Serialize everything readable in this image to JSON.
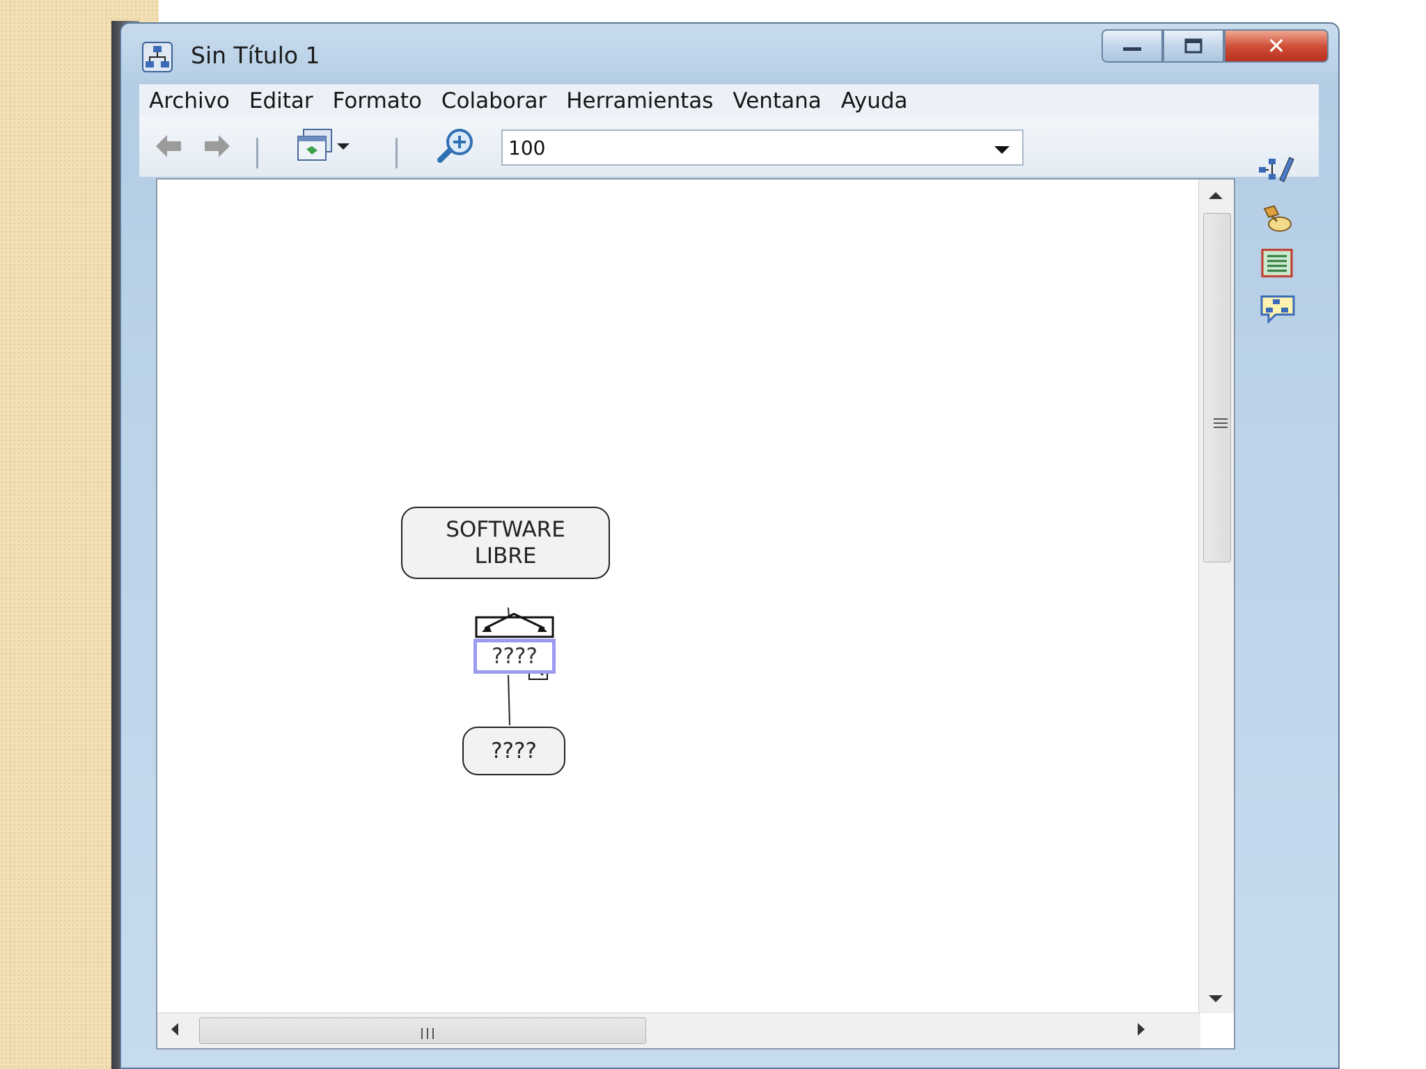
{
  "window": {
    "title": "Sin Título 1",
    "close_label": "✕"
  },
  "menu": [
    "Archivo",
    "Editar",
    "Formato",
    "Colaborar",
    "Herramientas",
    "Ventana",
    "Ayuda"
  ],
  "toolbar": {
    "zoom_value": "100"
  },
  "map": {
    "root_concept_line1": "SOFTWARE",
    "root_concept_line2": "LIBRE",
    "link_phrase": "????",
    "child_concept": "????"
  },
  "colors": {
    "window_frame": "#b4cde4",
    "close_button": "#d0503a",
    "link_selection": "#9a9af0",
    "concept_fill": "#f2f2f2"
  }
}
